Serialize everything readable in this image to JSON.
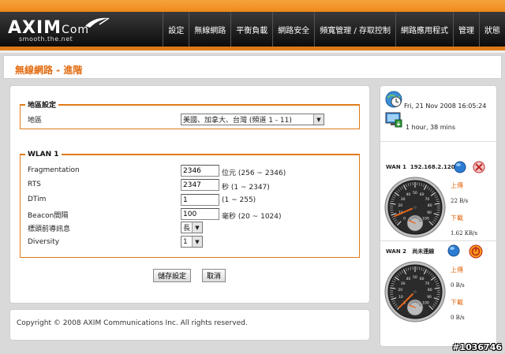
{
  "brand": {
    "name": "AXIM",
    "suffix": "Com",
    "tagline": "smooth.the.net"
  },
  "nav": [
    "設定",
    "無線網路",
    "平衡負載",
    "網路安全",
    "頻寬管理 / 存取控制",
    "網路應用程式",
    "管理",
    "狀態"
  ],
  "page": {
    "title": "無線網路 - 進階"
  },
  "region": {
    "legend": "地區設定",
    "label": "地區",
    "selected": "美國、加拿大、台灣 (頻道 1 - 11)"
  },
  "wlan": {
    "legend": "WLAN 1",
    "fields": {
      "fragmentation": {
        "label": "Fragmentation",
        "value": "2346",
        "note": "位元 (256 ~ 2346)"
      },
      "rts": {
        "label": "RTS",
        "value": "2347",
        "note": "秒 (1 ~ 2347)"
      },
      "dtim": {
        "label": "DTim",
        "value": "1",
        "note": "(1 ~ 255)"
      },
      "beacon": {
        "label": "Beacon間隔",
        "value": "100",
        "note": "毫秒 (20 ~ 1024)"
      },
      "preamble": {
        "label": "標頭前導訊息",
        "selected": "長"
      },
      "diversity": {
        "label": "Diversity",
        "selected": "1"
      }
    }
  },
  "buttons": {
    "save": "儲存設定",
    "cancel": "取消"
  },
  "footer": {
    "copyright": "Copyright © 2008 AXIM Communications Inc. All rights reserved."
  },
  "status": {
    "datetime": "Fri, 21 Nov 2008 16:05:24",
    "uptime": "1 hour, 38 mins",
    "wan1": {
      "label": "WAN 1",
      "ip": "192.168.2.120",
      "up_label": "上傳",
      "up_rate": "22 B/s",
      "down_label": "下載",
      "down_rate": "1.62 KB/s",
      "up_level": 0.02,
      "down_level": 0.08
    },
    "wan2": {
      "label": "WAN 2",
      "ip": "尚未連線",
      "up_label": "上傳",
      "up_rate": "0 B/s",
      "down_label": "下載",
      "down_rate": "0 B/s",
      "up_level": 0,
      "down_level": 0
    }
  },
  "watermark": "#1036746",
  "colors": {
    "accent": "#e07a18",
    "title": "#e26b10",
    "header": "#1a1a1a"
  }
}
